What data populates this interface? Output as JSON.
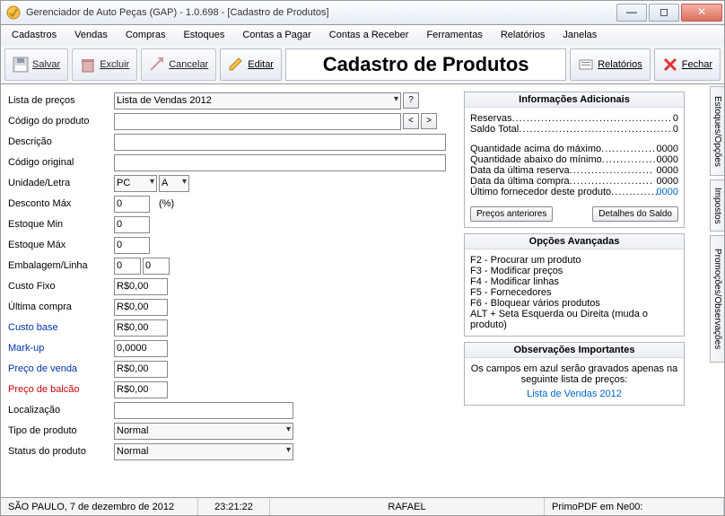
{
  "window": {
    "title": "Gerenciador de Auto Peças (GAP) - 1.0.698 - [Cadastro de Produtos]"
  },
  "menu": {
    "items": [
      "Cadastros",
      "Vendas",
      "Compras",
      "Estoques",
      "Contas a Pagar",
      "Contas a Receber",
      "Ferramentas",
      "Relatórios",
      "Janelas"
    ]
  },
  "toolbar": {
    "salvar": "Salvar",
    "excluir": "Excluir",
    "cancelar": "Cancelar",
    "editar": "Editar",
    "relatorios": "Relatórios",
    "fechar": "Fechar",
    "page_title": "Cadastro de Produtos"
  },
  "form": {
    "labels": {
      "lista": "Lista de preços",
      "codigo": "Código do produto",
      "descricao": "Descrição",
      "cod_original": "Código original",
      "unidade": "Unidade/Letra",
      "desconto": "Desconto Máx",
      "desconto_suffix": "(%)",
      "est_min": "Estoque Min",
      "est_max": "Estoque Máx",
      "embalagem": "Embalagem/Linha",
      "custo_fixo": "Custo Fixo",
      "ult_compra": "Última compra",
      "custo_base": "Custo base",
      "markup": "Mark-up",
      "preco_venda": "Preço de venda",
      "preco_balcao": "Preço de balcão",
      "localizacao": "Localização",
      "tipo": "Tipo de produto",
      "status": "Status do produto"
    },
    "values": {
      "lista": "Lista de Vendas 2012",
      "codigo": "",
      "descricao": "",
      "cod_original": "",
      "unidade": "PC",
      "letra": "A",
      "desconto": "0",
      "est_min": "0",
      "est_max": "0",
      "emb1": "0",
      "emb2": "0",
      "custo_fixo": "R$0,00",
      "ult_compra": "R$0,00",
      "custo_base": "R$0,00",
      "markup": "0,0000",
      "preco_venda": "R$0,00",
      "preco_balcao": "R$0,00",
      "localizacao": "",
      "tipo": "Normal",
      "status": "Normal"
    },
    "btn_help": "?",
    "btn_prev": "<",
    "btn_next": ">"
  },
  "info": {
    "title": "Informações Adicionais",
    "lines": [
      {
        "label": "Reservas",
        "value": "0"
      },
      {
        "label": "Saldo Total",
        "value": "0"
      }
    ],
    "lines2": [
      {
        "label": "Quantidade acima do máximo",
        "value": "0000"
      },
      {
        "label": "Quantidade abaixo do mínimo",
        "value": "0000"
      },
      {
        "label": "Data da última reserva",
        "value": "0000"
      },
      {
        "label": "Data da última compra",
        "value": "0000"
      },
      {
        "label": "Último fornecedor deste produto",
        "value": "0000",
        "blue": true
      }
    ],
    "btn_precos": "Preços anteriores",
    "btn_saldo": "Detalhes do Saldo"
  },
  "advanced": {
    "title": "Opções Avançadas",
    "items": [
      "F2 - Procurar um produto",
      "F3 - Modificar preços",
      "F4 - Modificar linhas",
      "F5 - Fornecedores",
      "F6 - Bloquear vários produtos",
      "ALT + Seta Esquerda ou Direita (muda o produto)"
    ]
  },
  "obs": {
    "title": "Observações Importantes",
    "text": "Os campos em azul serão gravados apenas na seguinte lista de preços:",
    "link": "Lista de Vendas 2012"
  },
  "vtabs": {
    "t1": "Estoques/Opções",
    "t2": "Impostos",
    "t3": "Promoções/Observações"
  },
  "status": {
    "local_date": "SÃO PAULO, 7 de dezembro de 2012",
    "time": "23:21:22",
    "user": "RAFAEL",
    "printer": "PrimoPDF em Ne00:"
  }
}
